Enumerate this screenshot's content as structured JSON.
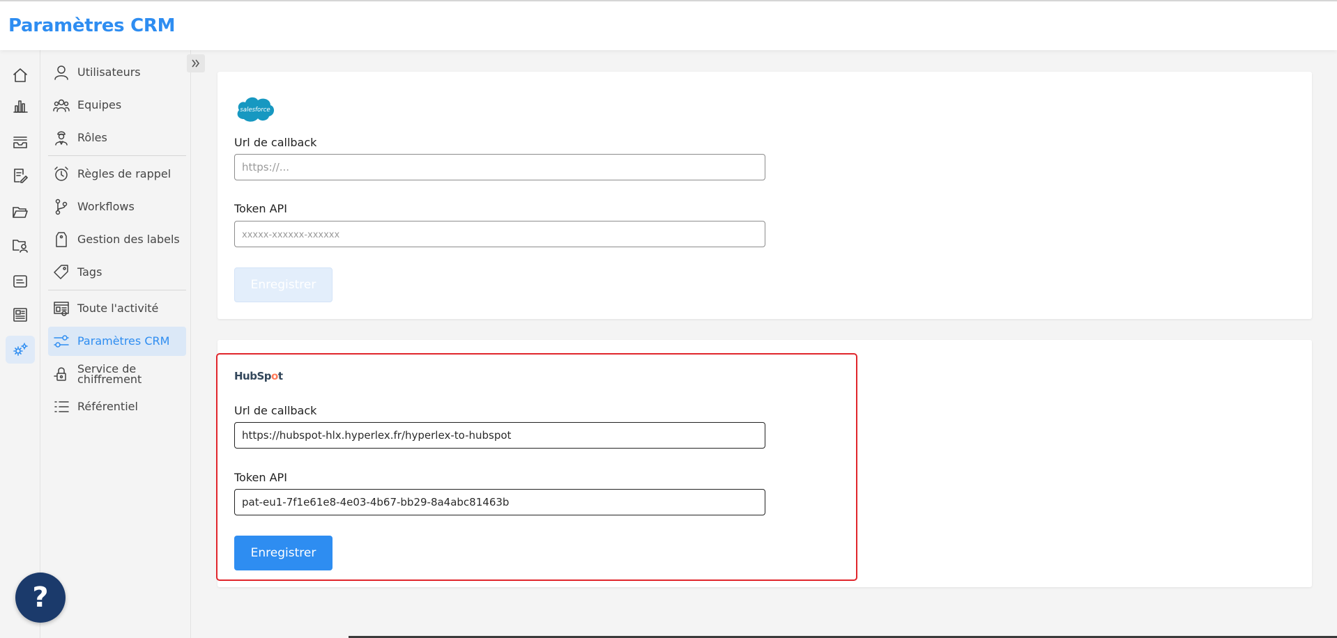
{
  "header": {
    "title": "Paramètres CRM"
  },
  "iconbar": [
    {
      "icon": "home-icon",
      "active": false
    },
    {
      "icon": "bar-chart-icon",
      "active": false
    },
    {
      "icon": "inbox-icon",
      "active": false
    },
    {
      "icon": "document-edit-icon",
      "active": false
    },
    {
      "icon": "folder-icon",
      "active": false
    },
    {
      "icon": "folder-user-icon",
      "active": false
    },
    {
      "icon": "list-card-icon",
      "active": false
    },
    {
      "icon": "newspaper-icon",
      "active": false
    },
    {
      "icon": "settings-gears-icon",
      "active": true
    }
  ],
  "menu": {
    "items": [
      {
        "label": "Utilisateurs",
        "icon": "user-icon"
      },
      {
        "label": "Equipes",
        "icon": "team-icon"
      },
      {
        "label": "Rôles",
        "icon": "role-icon"
      },
      {
        "label": "Règles de rappel",
        "icon": "alarm-clock-icon"
      },
      {
        "label": "Workflows",
        "icon": "workflow-icon"
      },
      {
        "label": "Gestion des labels",
        "icon": "label-tag-icon"
      },
      {
        "label": "Tags",
        "icon": "tag-icon"
      },
      {
        "label": "Toute l'activité",
        "icon": "activity-icon"
      },
      {
        "label": "Paramètres CRM",
        "icon": "sliders-icon",
        "active": true
      },
      {
        "label": "Service de chiffrement",
        "icon": "lock-icon"
      },
      {
        "label": "Référentiel",
        "icon": "list-icon"
      }
    ]
  },
  "salesforce": {
    "logo_text": "salesforce",
    "callback_label": "Url de callback",
    "callback_value": "",
    "callback_placeholder": "https://...",
    "token_label": "Token API",
    "token_value": "",
    "token_placeholder": "xxxxx-xxxxxx-xxxxxx",
    "save_label": "Enregistrer",
    "save_disabled": true
  },
  "hubspot": {
    "logo_text_a": "HubSp",
    "logo_text_b": "o",
    "logo_text_c": "t",
    "callback_label": "Url de callback",
    "callback_value": "https://hubspot-hlx.hyperlex.fr/hyperlex-to-hubspot",
    "token_label": "Token API",
    "token_value": "pat-eu1-7f1e61e8-4e03-4b67-bb29-8a4abc81463b",
    "save_label": "Enregistrer",
    "save_disabled": false
  },
  "help": {
    "label": "?"
  },
  "colors": {
    "accent": "#2e8df1",
    "highlight": "#e0252b",
    "help_bg": "#1b3a6b"
  }
}
